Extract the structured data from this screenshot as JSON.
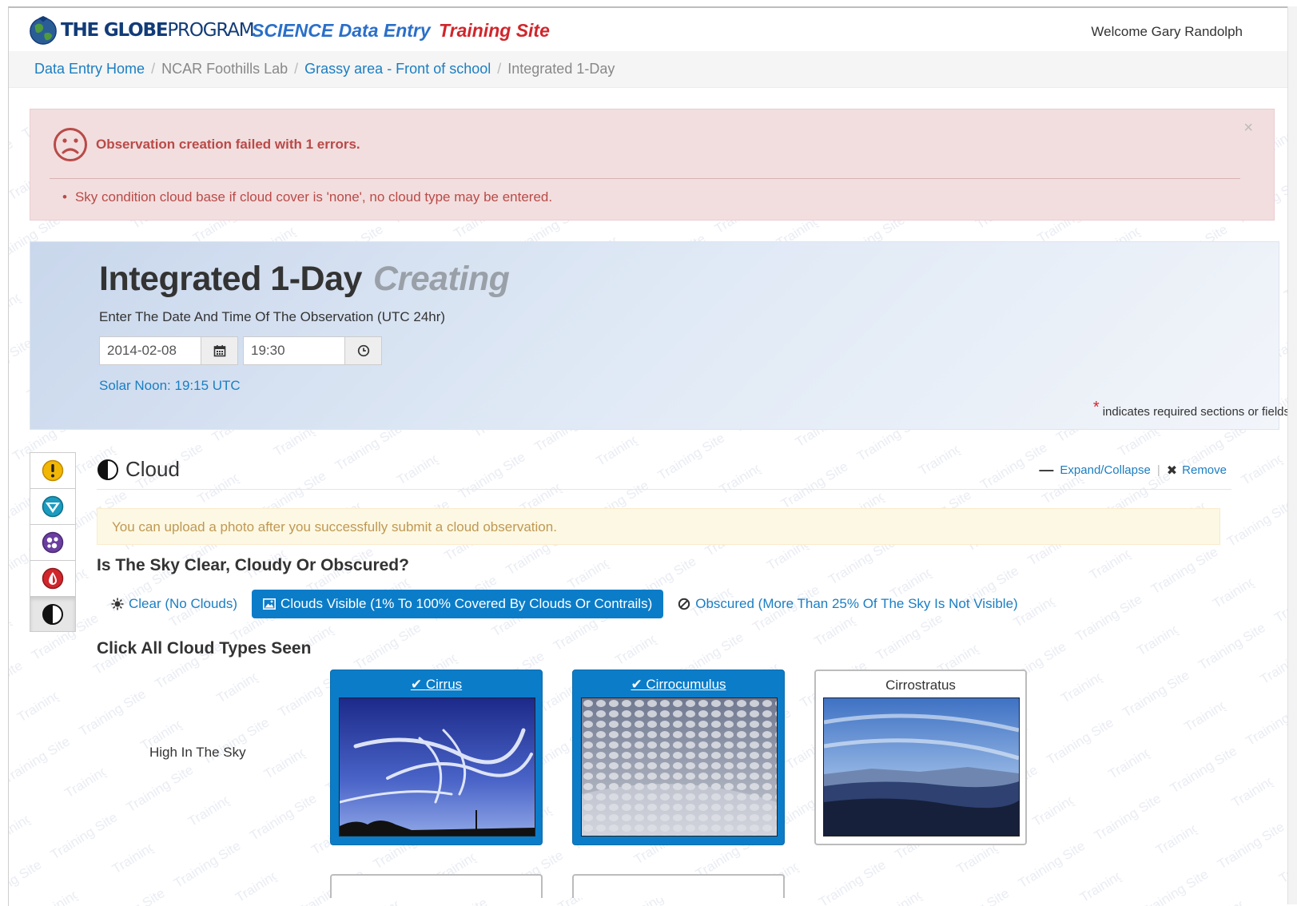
{
  "brand": {
    "logo_text_bold": "THE GLOBE",
    "logo_text_light": "PROGRAM",
    "science_title": "SCIENCE Data Entry",
    "training_title": "Training Site",
    "welcome": "Welcome Gary Randolph",
    "watermark_text": "Training Site"
  },
  "breadcrumb": {
    "items": [
      {
        "label": "Data Entry Home",
        "link": true
      },
      {
        "label": "NCAR Foothills Lab",
        "link": false
      },
      {
        "label": "Grassy area - Front of school",
        "link": true
      },
      {
        "label": "Integrated 1-Day",
        "link": false
      }
    ],
    "separator": "/"
  },
  "alert": {
    "title": "Observation creation failed with 1 errors.",
    "close_glyph": "×",
    "errors": [
      "Sky condition cloud base if cloud cover is 'none', no cloud type may be entered."
    ]
  },
  "form": {
    "title": "Integrated 1-Day",
    "status": "Creating",
    "date_label": "Enter The Date And Time Of The Observation (UTC 24hr)",
    "date_value": "2014-02-08",
    "time_value": "19:30",
    "solar_noon": "Solar Noon: 19:15 UTC",
    "required_star": "*",
    "required_note": "indicates required sections or fields"
  },
  "sidenav": {
    "items": [
      {
        "icon": "exclamation-icon",
        "color": "#f2b705"
      },
      {
        "icon": "compass-icon",
        "color": "#1c9bbf"
      },
      {
        "icon": "molecule-icon",
        "color": "#6b3fa0"
      },
      {
        "icon": "drop-icon",
        "color": "#d0262c"
      },
      {
        "icon": "half-circle-icon",
        "color": "#222222",
        "active": true
      }
    ]
  },
  "cloud_section": {
    "title": "Cloud",
    "expand_label": "Expand/Collapse",
    "remove_label": "Remove",
    "upload_notice": "You can upload a photo after you successfully submit a cloud observation.",
    "sky_question": "Is The Sky Clear, Cloudy Or Obscured?",
    "sky_options": [
      {
        "label": "Clear (No Clouds)",
        "icon": "sun-icon",
        "active": false
      },
      {
        "label": "Clouds Visible (1% To 100% Covered By Clouds Or Contrails)",
        "icon": "picture-icon",
        "active": true
      },
      {
        "label": "Obscured (More Than 25% Of The Sky Is Not Visible)",
        "icon": "ban-icon",
        "active": false
      }
    ],
    "types_question": "Click All Cloud Types Seen",
    "row_label": "High In The Sky",
    "cloud_types": [
      {
        "name": "Cirrus",
        "selected": true
      },
      {
        "name": "Cirrocumulus",
        "selected": true
      },
      {
        "name": "Cirrostratus",
        "selected": false
      }
    ]
  },
  "colors": {
    "link": "#1b7ec2",
    "primary": "#0b7cc8",
    "danger": "#b94a48",
    "warning_text": "#c09853",
    "brand_red": "#d0262c"
  }
}
